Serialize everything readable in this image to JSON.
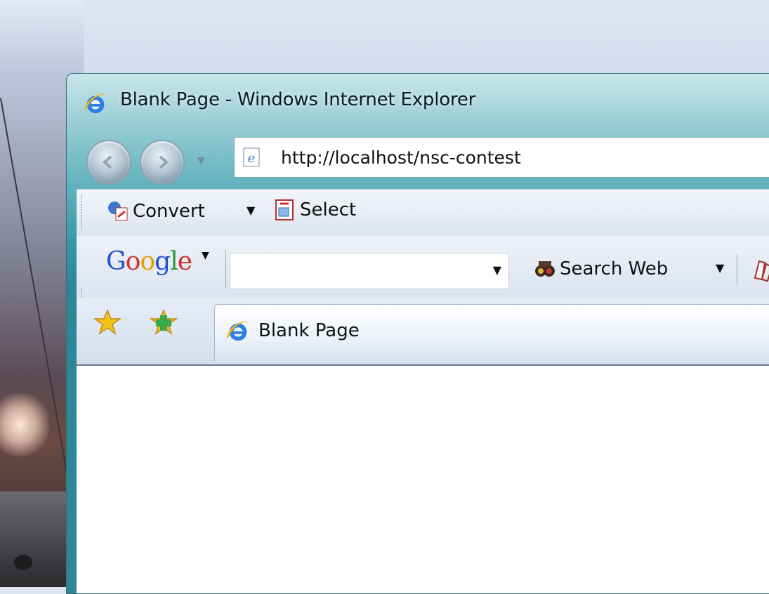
{
  "window": {
    "title": "Blank Page - Windows Internet Explorer",
    "accent_color": "#2d8796"
  },
  "nav": {
    "back_icon": "back-arrow-icon",
    "forward_icon": "forward-arrow-icon",
    "history_dropdown_icon": "chevron-down-icon"
  },
  "address_bar": {
    "value": "http://localhost/nsc-contest",
    "icon": "ie-page-icon"
  },
  "toolbar1": {
    "convert_label": "Convert",
    "select_label": "Select"
  },
  "toolbar2": {
    "google_logo": {
      "G": "G",
      "o1": "o",
      "o2": "o",
      "g": "g",
      "l": "l",
      "e": "e"
    },
    "search_value": "",
    "search_web_label": "Search Web"
  },
  "tabs": {
    "active_tab_label": "Blank Page"
  }
}
